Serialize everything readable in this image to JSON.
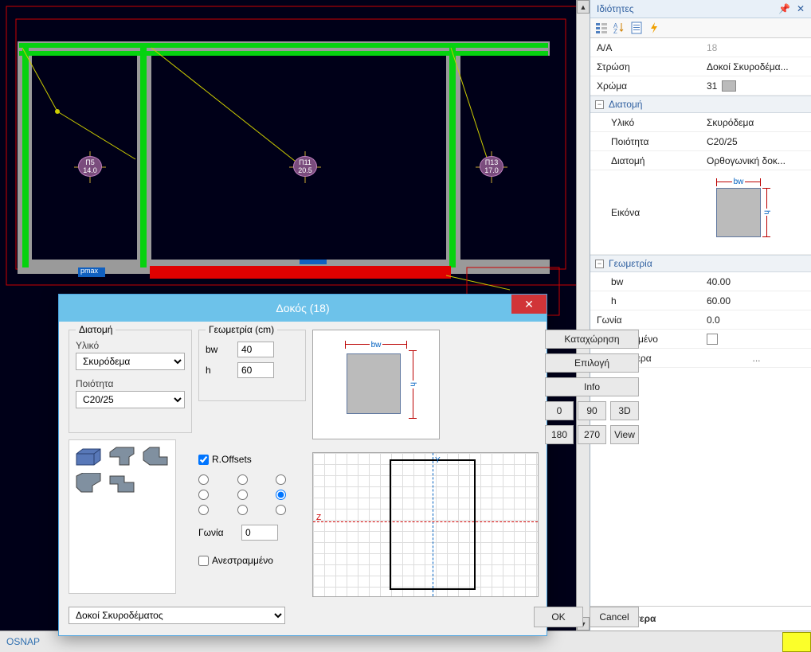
{
  "properties": {
    "title": "Ιδιότητες",
    "rows": {
      "aa_label": "Α/Α",
      "aa_value": "18",
      "layer_label": "Στρώση",
      "layer_value": "Δοκοί Σκυροδέμα...",
      "color_label": "Χρώμα",
      "color_value": "31"
    },
    "section_group": "Διατομή",
    "section": {
      "material_label": "Υλικό",
      "material_value": "Σκυρόδεμα",
      "quality_label": "Ποιότητα",
      "quality_value": "C20/25",
      "section_label": "Διατομή",
      "section_value": "Ορθογωνική  δοκ...",
      "image_label": "Εικόνα",
      "bw_tag": "bw",
      "h_tag": "h"
    },
    "geom_group": "Γεωμετρία",
    "geom": {
      "bw_label": "bw",
      "bw_value": "40.00",
      "h_label": "h",
      "h_value": "60.00",
      "angle_label": "Γωνία",
      "angle_value": "0.0",
      "flip_label": "Ανεστραμμένο",
      "more_label": "Περισσότερα",
      "more_value": "..."
    },
    "footer": "Περισσότερα"
  },
  "status": {
    "osnap": "OSNAP"
  },
  "dialog": {
    "title": "Δοκός (18)",
    "section_legend": "Διατομή",
    "material_label": "Υλικό",
    "material_value": "Σκυρόδεμα",
    "quality_label": "Ποιότητα",
    "quality_value": "C20/25",
    "geom_legend": "Γεωμετρία (cm)",
    "bw_label": "bw",
    "bw_value": "40",
    "h_label": "h",
    "h_value": "60",
    "roffsets": "R.Offsets",
    "angle_label": "Γωνία",
    "angle_value": "0",
    "flip_label": "Ανεστραμμένο",
    "type_select": "Δοκοί Σκυροδέματος",
    "bw_tag": "bw",
    "h_tag": "h",
    "btns": {
      "register": "Καταχώρηση",
      "select": "Επιλογή",
      "info": "Info",
      "r0": "0",
      "r90": "90",
      "r3d": "3D",
      "r180": "180",
      "r270": "270",
      "rview": "View",
      "ok": "OK",
      "cancel": "Cancel"
    },
    "detail": {
      "ylab": "Y",
      "zlab": "Z"
    }
  },
  "cad": {
    "t5_name": "Π5",
    "t5_val": "14.0",
    "t11_name": "Π11",
    "t11_val": "20.5",
    "t13_name": "Π13",
    "t13_val": "17.0",
    "pmax": "pmax"
  }
}
